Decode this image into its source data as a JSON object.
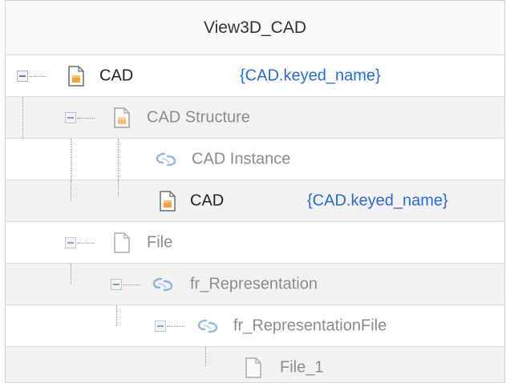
{
  "header": {
    "title": "View3D_CAD"
  },
  "rows": [
    {
      "label": "CAD",
      "keyed": "{CAD.keyed_name}",
      "icon": "cad-item-icon",
      "expander": true
    },
    {
      "label": "CAD Structure",
      "icon": "cad-item-icon",
      "expander": true
    },
    {
      "label": "CAD Instance",
      "icon": "relationship-icon",
      "expander": false
    },
    {
      "label": "CAD",
      "keyed": "{CAD.keyed_name}",
      "icon": "cad-item-icon",
      "expander": false
    },
    {
      "label": "File",
      "icon": "file-icon",
      "expander": true
    },
    {
      "label": "fr_Representation",
      "icon": "relationship-icon",
      "expander": true
    },
    {
      "label": "fr_RepresentationFile",
      "icon": "relationship-icon",
      "expander": true
    },
    {
      "label": "File_1",
      "icon": "file-icon",
      "expander": false
    }
  ]
}
